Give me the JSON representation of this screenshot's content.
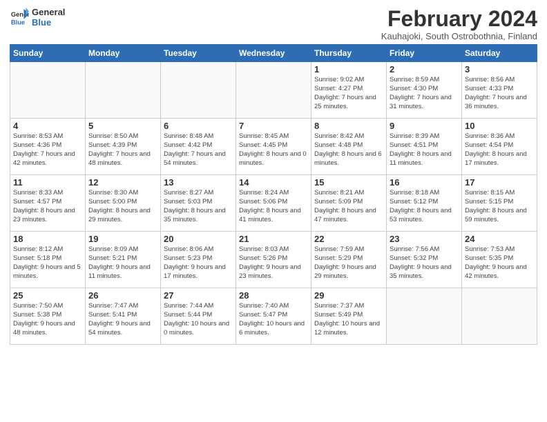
{
  "header": {
    "logo_general": "General",
    "logo_blue": "Blue",
    "month_title": "February 2024",
    "location": "Kauhajoki, South Ostrobothnia, Finland"
  },
  "days_of_week": [
    "Sunday",
    "Monday",
    "Tuesday",
    "Wednesday",
    "Thursday",
    "Friday",
    "Saturday"
  ],
  "weeks": [
    [
      {
        "day": "",
        "info": ""
      },
      {
        "day": "",
        "info": ""
      },
      {
        "day": "",
        "info": ""
      },
      {
        "day": "",
        "info": ""
      },
      {
        "day": "1",
        "info": "Sunrise: 9:02 AM\nSunset: 4:27 PM\nDaylight: 7 hours\nand 25 minutes."
      },
      {
        "day": "2",
        "info": "Sunrise: 8:59 AM\nSunset: 4:30 PM\nDaylight: 7 hours\nand 31 minutes."
      },
      {
        "day": "3",
        "info": "Sunrise: 8:56 AM\nSunset: 4:33 PM\nDaylight: 7 hours\nand 36 minutes."
      }
    ],
    [
      {
        "day": "4",
        "info": "Sunrise: 8:53 AM\nSunset: 4:36 PM\nDaylight: 7 hours\nand 42 minutes."
      },
      {
        "day": "5",
        "info": "Sunrise: 8:50 AM\nSunset: 4:39 PM\nDaylight: 7 hours\nand 48 minutes."
      },
      {
        "day": "6",
        "info": "Sunrise: 8:48 AM\nSunset: 4:42 PM\nDaylight: 7 hours\nand 54 minutes."
      },
      {
        "day": "7",
        "info": "Sunrise: 8:45 AM\nSunset: 4:45 PM\nDaylight: 8 hours\nand 0 minutes."
      },
      {
        "day": "8",
        "info": "Sunrise: 8:42 AM\nSunset: 4:48 PM\nDaylight: 8 hours\nand 6 minutes."
      },
      {
        "day": "9",
        "info": "Sunrise: 8:39 AM\nSunset: 4:51 PM\nDaylight: 8 hours\nand 11 minutes."
      },
      {
        "day": "10",
        "info": "Sunrise: 8:36 AM\nSunset: 4:54 PM\nDaylight: 8 hours\nand 17 minutes."
      }
    ],
    [
      {
        "day": "11",
        "info": "Sunrise: 8:33 AM\nSunset: 4:57 PM\nDaylight: 8 hours\nand 23 minutes."
      },
      {
        "day": "12",
        "info": "Sunrise: 8:30 AM\nSunset: 5:00 PM\nDaylight: 8 hours\nand 29 minutes."
      },
      {
        "day": "13",
        "info": "Sunrise: 8:27 AM\nSunset: 5:03 PM\nDaylight: 8 hours\nand 35 minutes."
      },
      {
        "day": "14",
        "info": "Sunrise: 8:24 AM\nSunset: 5:06 PM\nDaylight: 8 hours\nand 41 minutes."
      },
      {
        "day": "15",
        "info": "Sunrise: 8:21 AM\nSunset: 5:09 PM\nDaylight: 8 hours\nand 47 minutes."
      },
      {
        "day": "16",
        "info": "Sunrise: 8:18 AM\nSunset: 5:12 PM\nDaylight: 8 hours\nand 53 minutes."
      },
      {
        "day": "17",
        "info": "Sunrise: 8:15 AM\nSunset: 5:15 PM\nDaylight: 8 hours\nand 59 minutes."
      }
    ],
    [
      {
        "day": "18",
        "info": "Sunrise: 8:12 AM\nSunset: 5:18 PM\nDaylight: 9 hours\nand 5 minutes."
      },
      {
        "day": "19",
        "info": "Sunrise: 8:09 AM\nSunset: 5:21 PM\nDaylight: 9 hours\nand 11 minutes."
      },
      {
        "day": "20",
        "info": "Sunrise: 8:06 AM\nSunset: 5:23 PM\nDaylight: 9 hours\nand 17 minutes."
      },
      {
        "day": "21",
        "info": "Sunrise: 8:03 AM\nSunset: 5:26 PM\nDaylight: 9 hours\nand 23 minutes."
      },
      {
        "day": "22",
        "info": "Sunrise: 7:59 AM\nSunset: 5:29 PM\nDaylight: 9 hours\nand 29 minutes."
      },
      {
        "day": "23",
        "info": "Sunrise: 7:56 AM\nSunset: 5:32 PM\nDaylight: 9 hours\nand 35 minutes."
      },
      {
        "day": "24",
        "info": "Sunrise: 7:53 AM\nSunset: 5:35 PM\nDaylight: 9 hours\nand 42 minutes."
      }
    ],
    [
      {
        "day": "25",
        "info": "Sunrise: 7:50 AM\nSunset: 5:38 PM\nDaylight: 9 hours\nand 48 minutes."
      },
      {
        "day": "26",
        "info": "Sunrise: 7:47 AM\nSunset: 5:41 PM\nDaylight: 9 hours\nand 54 minutes."
      },
      {
        "day": "27",
        "info": "Sunrise: 7:44 AM\nSunset: 5:44 PM\nDaylight: 10 hours\nand 0 minutes."
      },
      {
        "day": "28",
        "info": "Sunrise: 7:40 AM\nSunset: 5:47 PM\nDaylight: 10 hours\nand 6 minutes."
      },
      {
        "day": "29",
        "info": "Sunrise: 7:37 AM\nSunset: 5:49 PM\nDaylight: 10 hours\nand 12 minutes."
      },
      {
        "day": "",
        "info": ""
      },
      {
        "day": "",
        "info": ""
      }
    ]
  ]
}
